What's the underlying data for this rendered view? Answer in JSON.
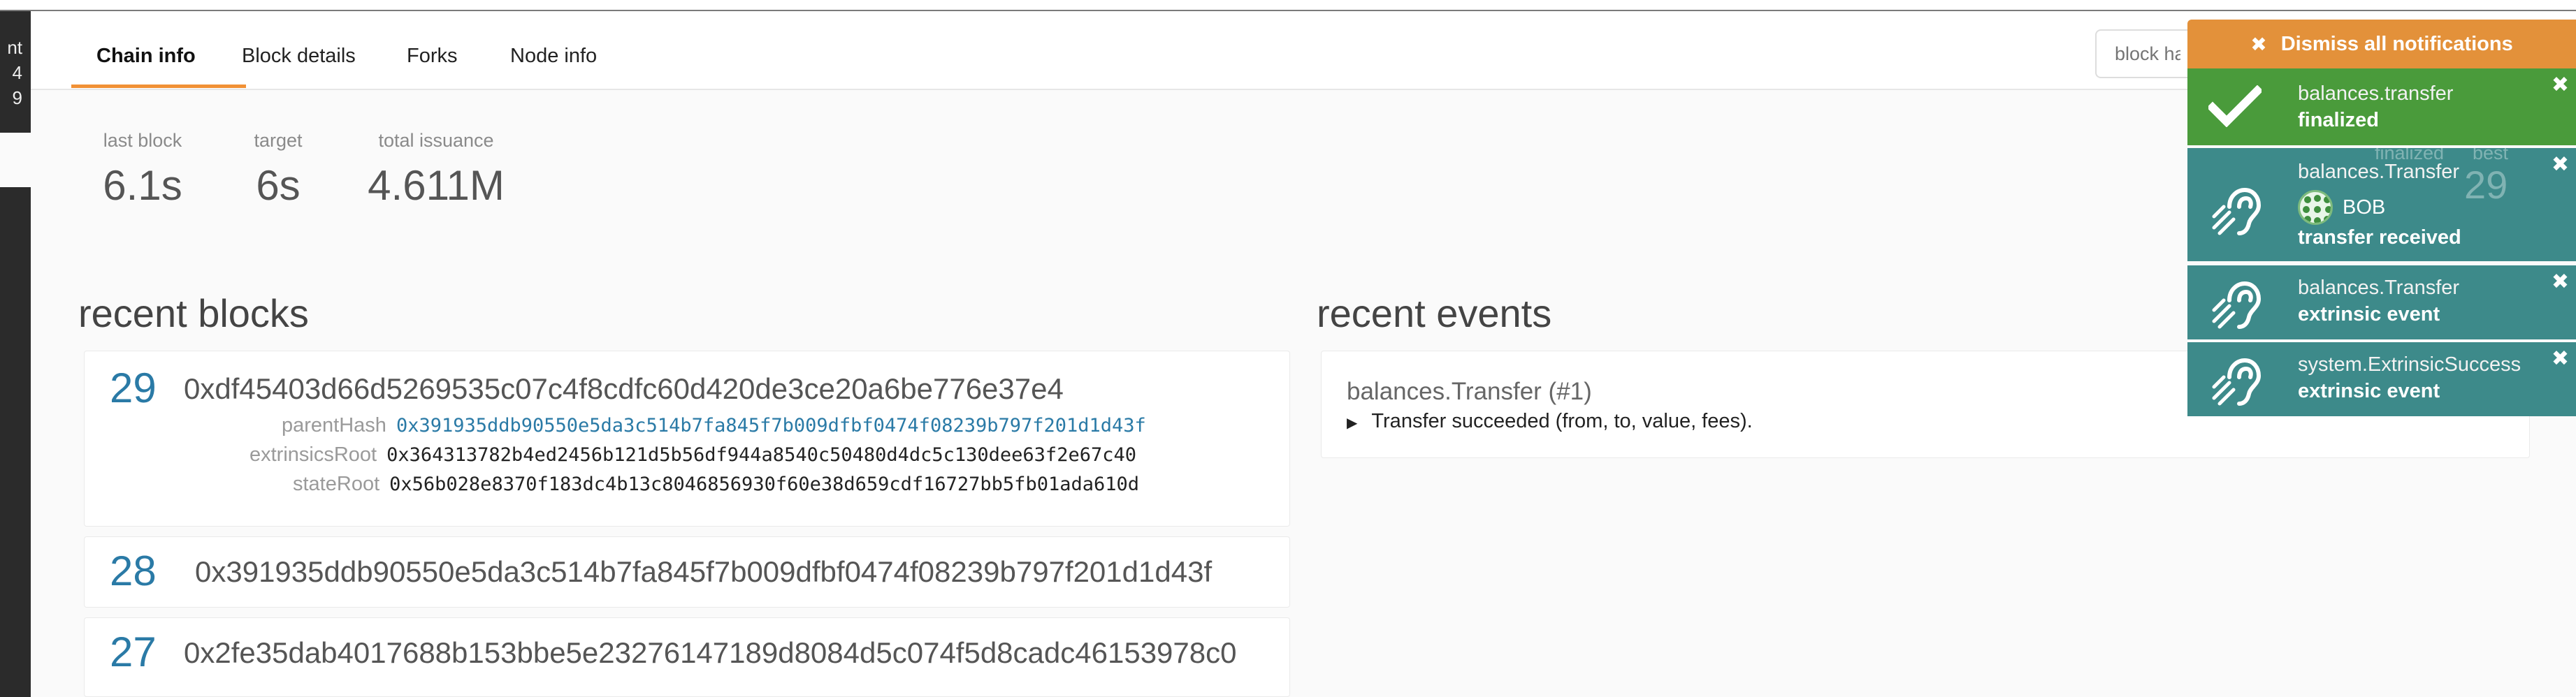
{
  "sidebar": {
    "lines": [
      "nt",
      "4",
      "9"
    ]
  },
  "tabs": [
    {
      "label": "Chain info"
    },
    {
      "label": "Block details"
    },
    {
      "label": "Forks"
    },
    {
      "label": "Node info"
    }
  ],
  "search": {
    "placeholder": "block hash or number to query"
  },
  "stats": [
    {
      "label": "last block",
      "value": "6.1s"
    },
    {
      "label": "target",
      "value": "6s"
    },
    {
      "label": "total issuance",
      "value": "4.611M"
    }
  ],
  "recent_blocks": {
    "title": "recent blocks",
    "blocks": [
      {
        "number": "29",
        "hash": "0xdf45403d66d5269535c07c4f8cdfc60d420de3ce20a6be776e37e4",
        "parentHash_label": "parentHash",
        "parentHash": "0x391935ddb90550e5da3c514b7fa845f7b009dfbf0474f08239b797f201d1d43f",
        "extrinsicsRoot_label": "extrinsicsRoot",
        "extrinsicsRoot": "0x364313782b4ed2456b121d5b56df944a8540c50480d4dc5c130dee63f2e67c40",
        "stateRoot_label": "stateRoot",
        "stateRoot": "0x56b028e8370f183dc4b13c8046856930f60e38d659cdf16727bb5fb01ada610d"
      },
      {
        "number": "28",
        "hash": "0x391935ddb90550e5da3c514b7fa845f7b009dfbf0474f08239b797f201d1d43f"
      },
      {
        "number": "27",
        "hash": "0x2fe35dab4017688b153bbe5e23276147189d8084d5c074f5d8cadc46153978c0"
      }
    ]
  },
  "recent_events": {
    "title": "recent events",
    "events": [
      {
        "title": "balances.Transfer (#1)",
        "detail": "Transfer succeeded (from, to, value, fees)."
      }
    ]
  },
  "notifications": {
    "dismiss_label": "Dismiss all notifications",
    "items": [
      {
        "color": "#4a9b3b",
        "icon": "check-icon",
        "title": "balances.transfer",
        "status": "finalized"
      },
      {
        "color": "#3d8a8a",
        "icon": "listening-icon",
        "title": "balances.Transfer",
        "account": "BOB",
        "status": "transfer received"
      },
      {
        "color": "#3d8a8a",
        "icon": "listening-icon",
        "title": "balances.Transfer",
        "status": "extrinsic event"
      },
      {
        "color": "#3d8a8a",
        "icon": "listening-icon",
        "title": "system.ExtrinsicSuccess",
        "status": "extrinsic event"
      }
    ],
    "ghost": {
      "left": "finalized",
      "right": "best",
      "num": "29"
    }
  },
  "colors": {
    "accent": "#f19135",
    "link": "#2a7aa6",
    "success": "#4a9b3b",
    "info": "#3d8a8a",
    "dismiss": "#e3913a"
  }
}
